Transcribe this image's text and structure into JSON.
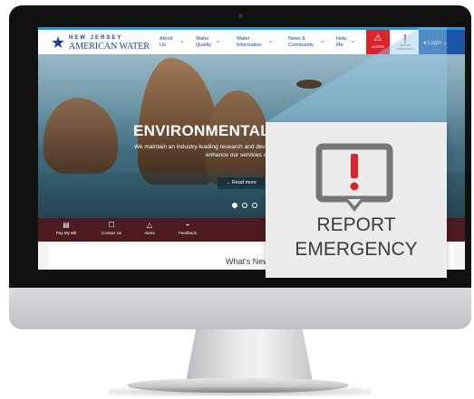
{
  "nav": {
    "logo_top": "NEW JERSEY",
    "logo_bottom": "AMERICAN WATER",
    "items": [
      {
        "label": "About Us"
      },
      {
        "label": "Water Quality"
      },
      {
        "label": "Water Information"
      },
      {
        "label": "News & Community"
      },
      {
        "label": "Help Me"
      }
    ],
    "alerts_label": "ALERTS",
    "report_label": "REPORT EMERGENCY",
    "login_label": "Login"
  },
  "hero": {
    "title": "ENVIRONMENTAL STEWARDSHIP",
    "subtitle": "We maintain an industry-leading research and development program that is designed to enhance our services and shape",
    "read_more": "Read more"
  },
  "quick_links": [
    {
      "label": "Pay My Bill",
      "icon": "bill-icon"
    },
    {
      "label": "Contact Us",
      "icon": "chat-icon"
    },
    {
      "label": "Alerts",
      "icon": "warning-icon"
    },
    {
      "label": "Feedback",
      "icon": "megaphone-icon"
    }
  ],
  "content": {
    "heading": "What's New"
  },
  "callout": {
    "label": "REPORT EMERGENCY",
    "icon": "exclamation-speech-bubble-icon",
    "icon_color": "#d7252e"
  },
  "colors": {
    "brand_blue": "#1b3f8f",
    "alert_red": "#d7252e",
    "login_blue": "#1b56a8",
    "quick_bar": "#4c1a1f"
  }
}
